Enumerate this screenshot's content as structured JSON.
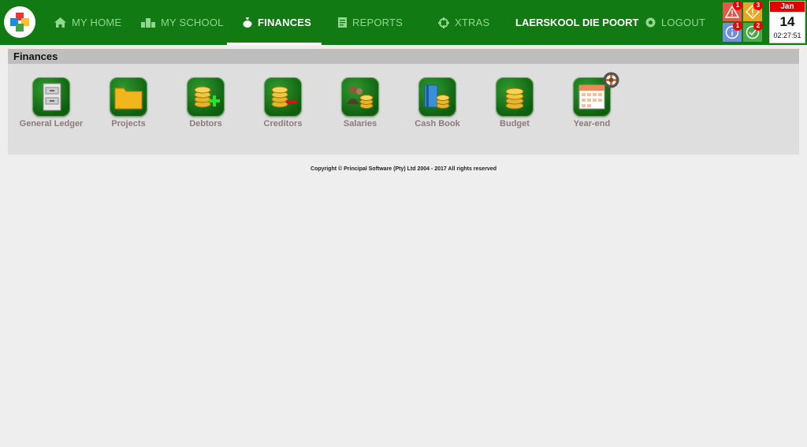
{
  "nav": {
    "items": [
      {
        "label": "MY HOME",
        "icon": "home-icon"
      },
      {
        "label": "MY SCHOOL",
        "icon": "school-icon"
      },
      {
        "label": "FINANCES",
        "icon": "money-bag-icon",
        "active": true
      },
      {
        "label": "REPORTS",
        "icon": "report-icon"
      },
      {
        "label": "XTRAS",
        "icon": "crosshair-icon"
      },
      {
        "label": "LOGOUT",
        "icon": "power-icon"
      }
    ],
    "school_name": "LAERSKOOL DIE POORT"
  },
  "alerts": [
    {
      "icon": "warning-icon",
      "count": "1",
      "color": "#e05a4a"
    },
    {
      "icon": "diamond-exclamation-icon",
      "count": "3",
      "color": "#e8a720"
    },
    {
      "icon": "info-icon",
      "count": "1",
      "color": "#6f8fd8"
    },
    {
      "icon": "check-icon",
      "count": "2",
      "color": "#4aa94a"
    }
  ],
  "calendar": {
    "month": "Jan",
    "day": "14",
    "time": "02:27:51"
  },
  "panel": {
    "title": "Finances",
    "modules": [
      {
        "label": "General Ledger",
        "icon": "filing-cabinet-icon"
      },
      {
        "label": "Projects",
        "icon": "folder-icon"
      },
      {
        "label": "Debtors",
        "icon": "coins-plus-icon"
      },
      {
        "label": "Creditors",
        "icon": "coins-minus-icon"
      },
      {
        "label": "Salaries",
        "icon": "people-coins-icon"
      },
      {
        "label": "Cash Book",
        "icon": "book-coins-icon"
      },
      {
        "label": "Budget",
        "icon": "coins-stack-icon"
      },
      {
        "label": "Year-end",
        "icon": "calendar-icon"
      }
    ]
  },
  "footer": {
    "copyright": "Copyright © Principal Software (Pty) Ltd 2004 - 2017 All rights reserved"
  },
  "colors": {
    "header_green": "#127a12",
    "nav_inactive": "#8fd98f",
    "label_color": "#8c7b7b"
  }
}
